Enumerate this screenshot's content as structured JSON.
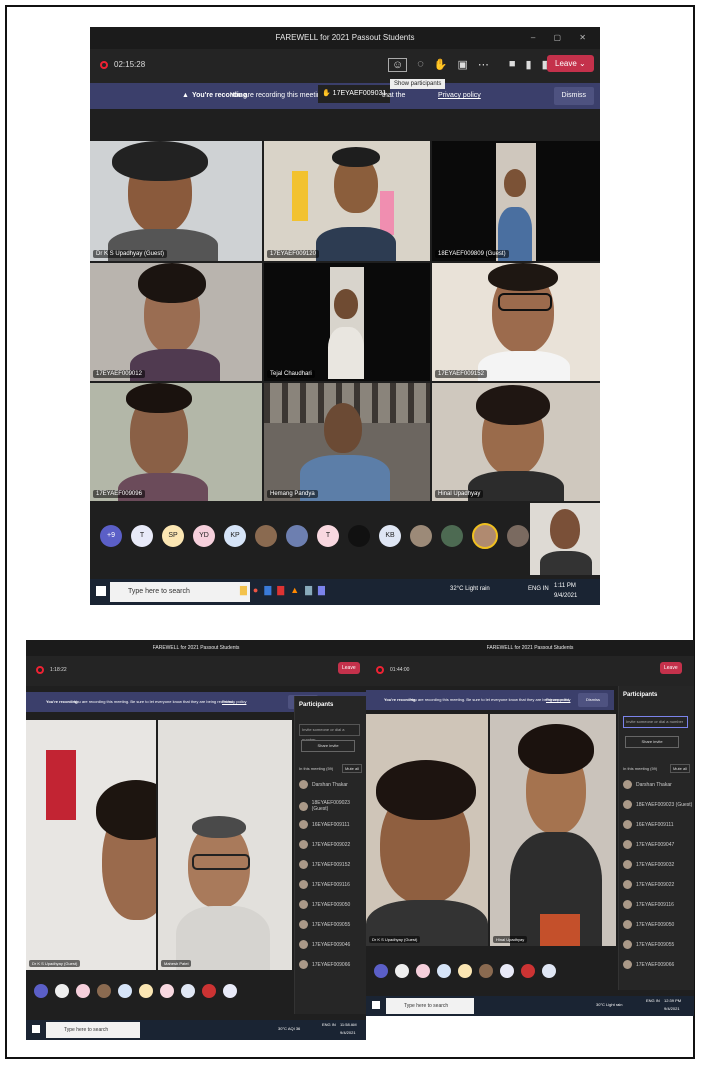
{
  "main": {
    "title": "FAREWELL for 2021 Passout Students",
    "window_controls": "– ▢ ✕",
    "timer": "02:15:28",
    "leave": "Leave",
    "banner_bold": "You're recording",
    "banner_text": "You are recording this meeting. Be sure",
    "banner_that": "that the",
    "banner_privacy": "Privacy policy",
    "dismiss": "Dismiss",
    "tooltip": "Show participants",
    "chip": "17EYAEF009031",
    "tiles": [
      {
        "name": "Dr K S Upadhyay (Guest)"
      },
      {
        "name": "17EYAEF009120"
      },
      {
        "name": "18EYAEF009809 (Guest)"
      },
      {
        "name": "17EYAEF009012"
      },
      {
        "name": "Tejal Chaudhari"
      },
      {
        "name": "17EYAEF009152"
      },
      {
        "name": "17EYAEF009096"
      },
      {
        "name": "Hemang Pandya"
      },
      {
        "name": "Hinal Upadhyay"
      }
    ],
    "avatars": [
      "+9",
      "T",
      "SP",
      "YD",
      "KP",
      "",
      "",
      "T",
      "",
      "KB",
      "",
      "",
      "",
      ""
    ],
    "search": "Type here to search",
    "weather": "32°C  Light rain",
    "lang": "ENG IN",
    "time": "1:11 PM",
    "date": "9/4/2021"
  },
  "left": {
    "title": "FAREWELL for 2021 Passout Students",
    "timer": "1:18:22",
    "leave": "Leave",
    "banner_bold": "You're recording",
    "banner_text": "You are recording this meeting. Be sure to let everyone know that they are being recorded.",
    "banner_privacy": "Privacy policy",
    "dismiss": "Dismiss",
    "participants_title": "Participants",
    "invite_placeholder": "Invite someone or dial a number",
    "share_invite": "Share invite",
    "in_meeting": "In this meeting (59)",
    "mute_all": "Mute all",
    "people": [
      "Darshan Thakar",
      "18EYAEF009023 (Guest)",
      "16EYAEF009111",
      "17EYAEF009022",
      "17EYAEF009152",
      "17EYAEF009116",
      "17EYAEF009050",
      "17EYAEF009055",
      "17EYAEF009046",
      "17EYAEF009066"
    ],
    "tile_names": [
      "Dr K S Upadhyay (Guest)",
      "Mahesh Patel"
    ],
    "search": "Type here to search",
    "weather": "30°C  AQI 36",
    "lang": "ENG IN",
    "time": "11:58 AM",
    "date": "9/4/2021"
  },
  "right": {
    "title": "FAREWELL for 2021 Passout Students",
    "timer": "01:44:00",
    "leave": "Leave",
    "banner_bold": "You're recording",
    "banner_text": "You are recording this meeting. Be sure to let everyone know that they are being recorded.",
    "banner_privacy": "Privacy policy",
    "dismiss": "Dismiss",
    "participants_title": "Participants",
    "invite_placeholder": "Invite someone or dial a number",
    "share_invite": "Share invite",
    "in_meeting": "In this meeting (59)",
    "mute_all": "Mute all",
    "people": [
      "Darshan Thakar",
      "18EYAEF009023 (Guest)",
      "16EYAEF009111",
      "17EYAEF009047",
      "17EYAEF009032",
      "17EYAEF009022",
      "17EYAEF009116",
      "17EYAEF009050",
      "17EYAEF009055",
      "17EYAEF009066"
    ],
    "tile_names": [
      "Dr K S Upadhyay (Guest)",
      "Hinal Upadhyay"
    ],
    "search": "Type here to search",
    "weather": "30°C  Light rain",
    "lang": "ENG IN",
    "time": "12:39 PM",
    "date": "9/4/2021"
  },
  "colors": {
    "leave": "#c4314b",
    "banner": "#3b3f6b",
    "window": "#1f1f1f",
    "taskbar": "#1a2433"
  }
}
